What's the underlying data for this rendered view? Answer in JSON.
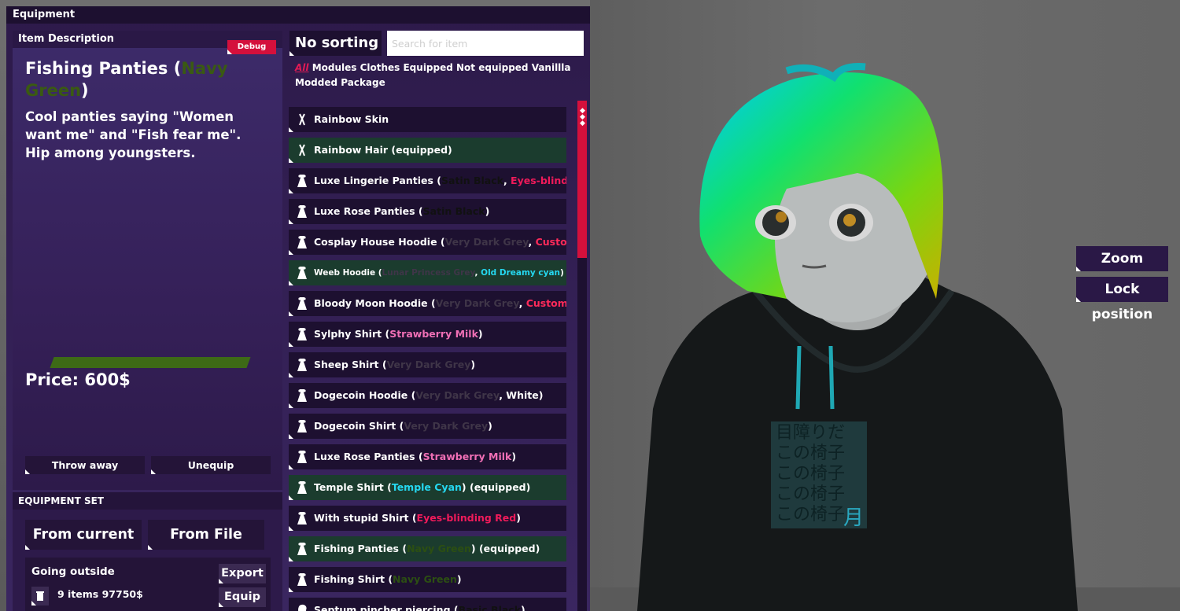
{
  "window": {
    "title": "Equipment"
  },
  "description": {
    "header": "Item Description",
    "debug_label": "Debug",
    "name_prefix": "Fishing Panties (",
    "name_color": "Navy Green",
    "name_suffix": ")",
    "text": "Cool panties saying \"Women want me\" and \"Fish fear me\". Hip among youngsters.",
    "price": "Price: 600$",
    "throw_away": "Throw away",
    "unequip": "Unequip"
  },
  "equipment_set": {
    "header": "EQUIPMENT SET",
    "from_current": "From current",
    "from_file": "From File",
    "entry_name": "Going outside",
    "entry_summary": "9 items 97750$",
    "export": "Export",
    "equip": "Equip"
  },
  "list_controls": {
    "sort_label": "No sorting",
    "search_placeholder": "Search for item",
    "filter_all": "All",
    "filter_rest": " Modules Clothes Equipped Not equipped Vanillla Modded Package"
  },
  "items": [
    {
      "icon": "tool-icon",
      "name": "Rainbow Skin",
      "parts": [],
      "equipped": false
    },
    {
      "icon": "tool-icon",
      "name": "Rainbow Hair (equipped)",
      "parts": [],
      "equipped": true
    },
    {
      "icon": "dress-icon",
      "name": "Luxe Lingerie Panties (",
      "parts": [
        [
          "Satin Black",
          "black"
        ],
        [
          ", ",
          ""
        ],
        [
          "Eyes-blinding Red",
          "red"
        ],
        [
          ")",
          ""
        ]
      ],
      "equipped": false
    },
    {
      "icon": "dress-icon",
      "name": "Luxe Rose Panties (",
      "parts": [
        [
          "Satin Black",
          "black"
        ],
        [
          ")",
          ""
        ]
      ],
      "equipped": false
    },
    {
      "icon": "dress-icon",
      "name": "Cosplay House Hoodie (",
      "parts": [
        [
          "Very Dark Grey",
          "grey"
        ],
        [
          ", ",
          ""
        ],
        [
          "Custom",
          "custom"
        ],
        [
          ")",
          ""
        ]
      ],
      "equipped": false
    },
    {
      "icon": "dress-icon",
      "name": "Weeb Hoodie (",
      "parts": [
        [
          "Lunar Princess Grey",
          "grey"
        ],
        [
          ", ",
          ""
        ],
        [
          "Old Dreamy cyan",
          "cyan"
        ],
        [
          ") (equipped)",
          ""
        ]
      ],
      "equipped": true,
      "small": true
    },
    {
      "icon": "dress-icon",
      "name": "Bloody Moon Hoodie (",
      "parts": [
        [
          "Very Dark Grey",
          "grey"
        ],
        [
          ", ",
          ""
        ],
        [
          "Custom",
          "custom"
        ],
        [
          ")",
          ""
        ]
      ],
      "equipped": false
    },
    {
      "icon": "dress-icon",
      "name": "Sylphy Shirt (",
      "parts": [
        [
          "Strawberry Milk",
          "pink"
        ],
        [
          ")",
          ""
        ]
      ],
      "equipped": false
    },
    {
      "icon": "dress-icon",
      "name": "Sheep Shirt (",
      "parts": [
        [
          "Very Dark Grey",
          "grey"
        ],
        [
          ")",
          ""
        ]
      ],
      "equipped": false
    },
    {
      "icon": "dress-icon",
      "name": "Dogecoin Hoodie (",
      "parts": [
        [
          "Very Dark Grey",
          "grey"
        ],
        [
          ", White)",
          ""
        ]
      ],
      "equipped": false
    },
    {
      "icon": "dress-icon",
      "name": "Dogecoin Shirt (",
      "parts": [
        [
          "Very Dark Grey",
          "grey"
        ],
        [
          ")",
          ""
        ]
      ],
      "equipped": false
    },
    {
      "icon": "dress-icon",
      "name": "Luxe Rose Panties (",
      "parts": [
        [
          "Strawberry Milk",
          "pink"
        ],
        [
          ")",
          ""
        ]
      ],
      "equipped": false
    },
    {
      "icon": "dress-icon",
      "name": "Temple Shirt (",
      "parts": [
        [
          "Temple Cyan",
          "cyan"
        ],
        [
          ") (equipped)",
          ""
        ]
      ],
      "equipped": true
    },
    {
      "icon": "dress-icon",
      "name": "With stupid Shirt (",
      "parts": [
        [
          "Eyes-blinding Red",
          "red"
        ],
        [
          ")",
          ""
        ]
      ],
      "equipped": false
    },
    {
      "icon": "dress-icon",
      "name": "Fishing Panties (",
      "parts": [
        [
          "Navy Green",
          "navy"
        ],
        [
          ") (equipped)",
          ""
        ]
      ],
      "equipped": true
    },
    {
      "icon": "dress-icon",
      "name": "Fishing Shirt (",
      "parts": [
        [
          "Navy Green",
          "navy"
        ],
        [
          ")",
          ""
        ]
      ],
      "equipped": false
    },
    {
      "icon": "ring-icon",
      "name": "Septum pincher piercing (",
      "parts": [
        [
          "Basic Black",
          "black"
        ],
        [
          ")",
          ""
        ]
      ],
      "equipped": false
    }
  ],
  "controls": {
    "zoom": "Zoom",
    "lock_position": "Lock position"
  },
  "hoodie_text": [
    "目障りだ",
    "この椅子",
    "この椅子",
    "この椅子",
    "この椅子"
  ],
  "hoodie_moon": "月",
  "colors": {
    "panel": "#2d1a4a",
    "accent_red": "#d4103c",
    "equipped_row": "#1b3c2e",
    "navy_green": "#3a5a12",
    "cyan": "#25d8f0",
    "pink": "#f06fb5"
  }
}
